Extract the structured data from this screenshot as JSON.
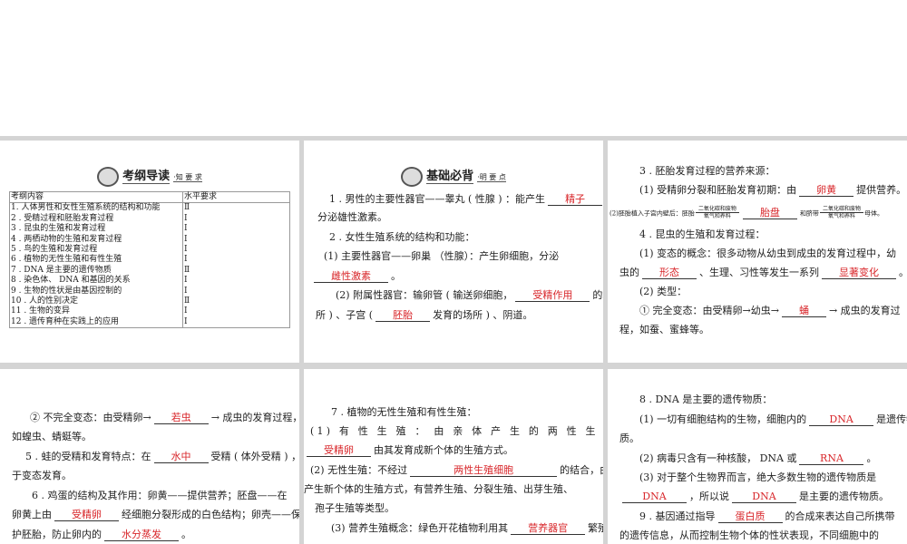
{
  "panel1": {
    "header": {
      "title": "考纲导读",
      "sub": "·知 要 求"
    },
    "table": {
      "headers": [
        "考纲内容",
        "水平要求"
      ],
      "rows": [
        [
          "1. 人体男性和女性生殖系统的结构和功能",
          "Ⅱ"
        ],
        [
          "2 . 受精过程和胚胎发育过程",
          "Ⅰ"
        ],
        [
          "3 . 昆虫的生殖和发育过程",
          "Ⅰ"
        ],
        [
          "4 . 两栖动物的生殖和发育过程",
          "Ⅰ"
        ],
        [
          "5 . 鸟的生殖和发育过程",
          "Ⅰ"
        ],
        [
          "6 . 植物的无性生殖和有性生殖",
          "Ⅰ"
        ],
        [
          "7 .  DNA 是主要的遗传物质",
          "Ⅱ"
        ],
        [
          "8 . 染色体、 DNA 和基因的关系",
          "Ⅰ"
        ],
        [
          "9 . 生物的性状是由基因控制的",
          "Ⅰ"
        ],
        [
          "10 . 人的性别决定",
          "Ⅱ"
        ],
        [
          "11 . 生物的变异",
          "Ⅰ"
        ],
        [
          "12 . 遗传育种在实践上的应用",
          "Ⅰ"
        ]
      ]
    }
  },
  "panel2": {
    "header": {
      "title": "基础必背",
      "sub": "·明 要 点"
    },
    "lines": [
      [
        "1 . 男性的主要性器官——睾丸 ( 性腺 ) ：能产生",
        {
          "b": "精子"
        },
        "，"
      ],
      [
        "分泌雄性激素。"
      ],
      [
        "2 . 女性生殖系统的结构和功能："
      ],
      [
        "(1) 主要性器官——卵巢 （性腺）：产生卵细胞，分泌"
      ],
      [
        {
          "b": "雌性激素"
        },
        "。"
      ],
      [
        "(2) 附属性器官：输卵管 ( 输送卵细胞，",
        {
          "b": "受精作用"
        },
        "的场"
      ],
      [
        "所 ) 、子宫 (",
        {
          "b": "胚胎"
        },
        "发育的场所 ) 、阴道。"
      ]
    ]
  },
  "panel3": {
    "lines": [
      [
        "3 . 胚胎发育过程的营养来源："
      ],
      [
        "(1) 受精卵分裂和胚胎发育初期：由",
        {
          "b": "卵黄"
        },
        "提供营养。"
      ],
      [
        {
          "s": "(2)胚胎植入子宫内壁后：胚胎"
        },
        {
          "f": [
            "二氧化碳和废物",
            "氧气和养料"
          ]
        },
        {
          "b": "胎盘"
        },
        {
          "s": "和脐带"
        },
        {
          "f": [
            "二氧化碳和废物",
            "氧气和养料"
          ]
        },
        {
          "s": "母体。"
        }
      ],
      [
        "4 . 昆虫的生殖和发育过程："
      ],
      [
        "(1) 变态的概念：很多动物从幼虫到成虫的发育过程中，幼"
      ],
      [
        "虫的",
        {
          "b": "形态"
        },
        "、生理、习性等发生一系列",
        {
          "b": "显著变化"
        },
        "。"
      ],
      [
        "(2) 类型："
      ],
      [
        "① 完全变态：由受精卵→幼虫→",
        {
          "b": "蛹"
        },
        "→ 成虫的发育过"
      ],
      [
        "程，如蚕、蜜蜂等。"
      ]
    ]
  },
  "panel4": {
    "lines": [
      [
        "② 不完全变态：由受精卵→",
        {
          "b": "若虫"
        },
        "→ 成虫的发育过程，"
      ],
      [
        "如蝗虫、蜻蜓等。"
      ],
      [
        "5 . 蛙的受精和发育特点：在",
        {
          "b": "水中"
        },
        "受精 ( 体外受精 ) ，属"
      ],
      [
        "于变态发育。"
      ],
      [
        "6 . 鸡蛋的结构及其作用：卵黄——提供营养；胚盘——在"
      ],
      [
        "卵黄上由",
        {
          "b": "受精卵"
        },
        "经细胞分裂形成的白色结构；卵壳——保"
      ],
      [
        "护胚胎，防止卵内的",
        {
          "b": "水分蒸发"
        },
        "。"
      ]
    ]
  },
  "panel5": {
    "lines": [
      [
        "7 . 植物的无性生殖和有性生殖："
      ],
      [
        "(1) 有 性 生 殖 ： 由 亲 体 产 生 的 两 性 生 殖 细 胞 结 合"
      ],
      [
        {
          "b": "受精卵"
        },
        "由其发育成新个体的生殖方式。"
      ],
      [
        "(2) 无性生殖：不经过",
        {
          "b": "两性生殖细胞"
        },
        "的结合，由母体直"
      ],
      [
        "产生新个体的生殖方式，有营养生殖、分裂生殖、出芽生殖、"
      ],
      [
        "孢子生殖等类型。"
      ],
      [
        "(3) 营养生殖概念：绿色开花植物利用其",
        {
          "b": "营养器官"
        },
        "繁殖"
      ]
    ]
  },
  "panel6": {
    "lines": [
      [
        "8 .  DNA 是主要的遗传物质："
      ],
      [
        "(1) 一切有细胞结构的生物，细胞内的",
        {
          "b": "DNA"
        },
        "是遗传物"
      ],
      [
        "质。"
      ],
      [
        "(2) 病毒只含有一种核酸， DNA 或",
        {
          "b": "RNA"
        },
        "。"
      ],
      [
        "(3) 对于整个生物界而言，绝大多数生物的遗传物质是"
      ],
      [
        {
          "b": "DNA"
        },
        "，所以说",
        {
          "b": "DNA"
        },
        "是主要的遗传物质。"
      ],
      [
        "9 . 基因通过指导",
        {
          "b": "蛋白质"
        },
        "的合成来表达自己所携带"
      ],
      [
        "的遗传信息，从而控制生物个体的性状表现，不同细胞中的"
      ]
    ]
  },
  "colors": {
    "answer": "#d8262a",
    "band": "#d4d4d4"
  }
}
